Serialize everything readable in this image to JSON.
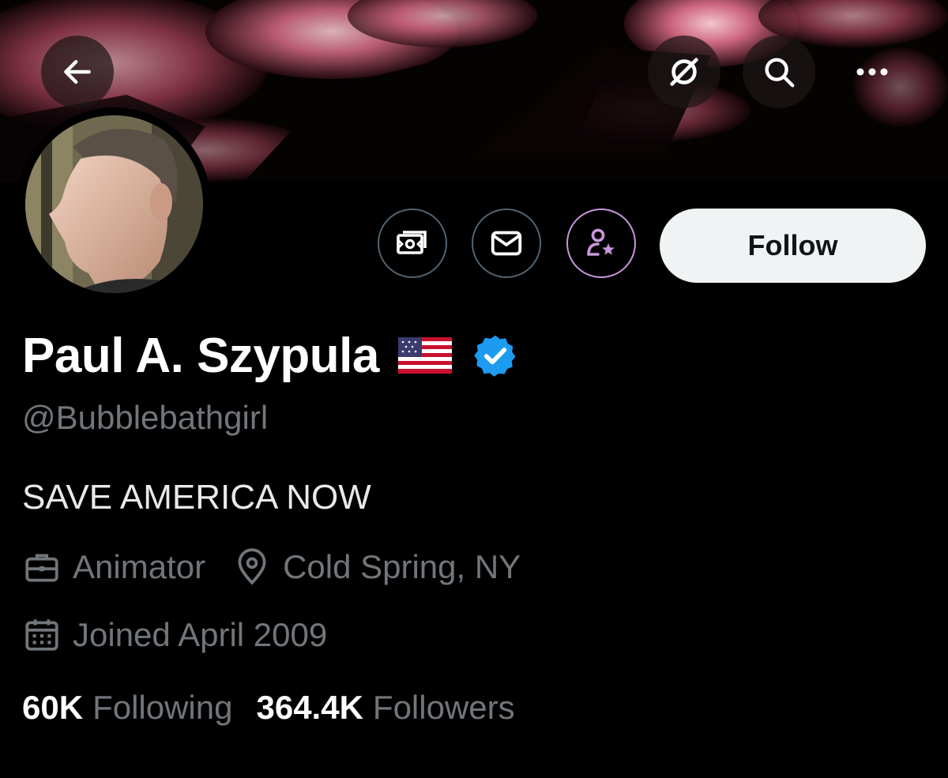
{
  "header": {
    "back_icon": "arrow-left-icon",
    "grok_icon": "grok-icon",
    "search_icon": "search-icon",
    "more_icon": "more-horizontal-icon"
  },
  "actions": {
    "tip_icon": "money-icon",
    "message_icon": "envelope-icon",
    "subscribe_icon": "person-star-icon",
    "follow_label": "Follow"
  },
  "profile": {
    "display_name": "Paul A. Szypula",
    "flag_icon": "us-flag-icon",
    "verified_icon": "verified-badge-icon",
    "handle": "@Bubblebathgirl",
    "bio": "SAVE AMERICA NOW",
    "profession": "Animator",
    "location": "Cold Spring, NY",
    "joined": "Joined April 2009"
  },
  "stats": {
    "following_count": "60K",
    "following_label": "Following",
    "followers_count": "364.4K",
    "followers_label": "Followers"
  },
  "colors": {
    "background": "#000000",
    "muted_text": "#71767b",
    "follow_button_bg": "#eff3f4",
    "verified_blue": "#1d9bf0",
    "subscribe_border": "#c996dc"
  }
}
